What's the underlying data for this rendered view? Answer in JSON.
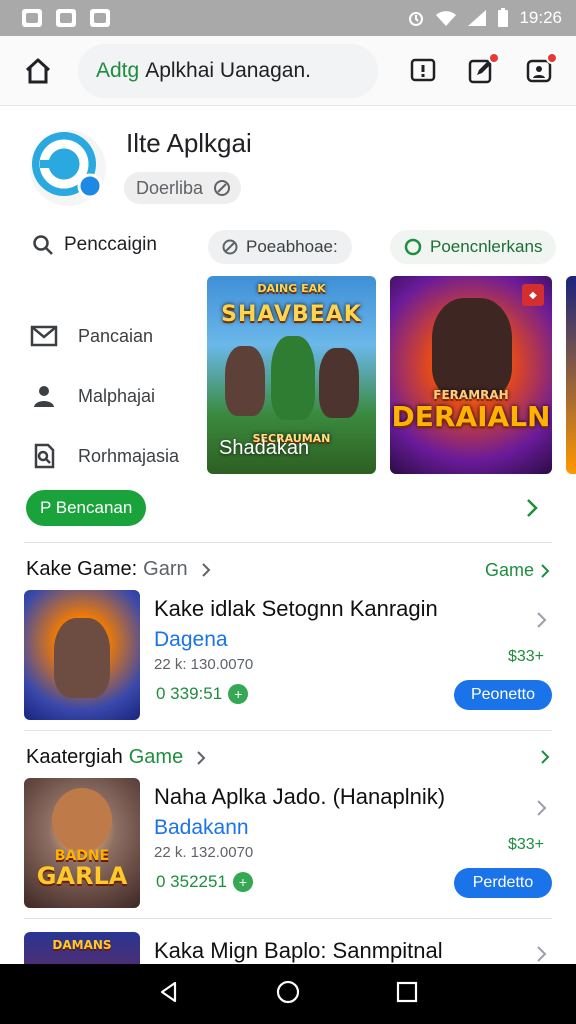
{
  "status_bar": {
    "time": "19:26"
  },
  "top_bar": {
    "search_prefix": "Adtg",
    "search_text": "Aplkhai Uanagan."
  },
  "app_header": {
    "title": "Ilte Aplkgai",
    "chip_label": "Doerliba"
  },
  "filters": {
    "search_label": "Penccaigin",
    "chip_1": "Poeabhoae:",
    "chip_2": "Poencnlerkans"
  },
  "side_menu": [
    {
      "label": "Pancaian",
      "icon": "mail-icon"
    },
    {
      "label": "Malphajai",
      "icon": "person-icon"
    },
    {
      "label": "Rorhmajasia",
      "icon": "document-search-icon"
    }
  ],
  "banners": [
    {
      "caption": "Shadakan",
      "art_title": "SHAVBEAK",
      "art_top": "DAING EAK",
      "art_sub": "SECRAUMAN"
    },
    {
      "art_title": "DERAIALN",
      "art_top": "FERAMRAH"
    }
  ],
  "cta": {
    "label": "P Bencanan"
  },
  "section_1": {
    "title": "Kake Game:",
    "sub": "Garn",
    "link": "Game"
  },
  "section_2": {
    "title": "Kaatergiah",
    "sub": "Game"
  },
  "apps": [
    {
      "title": "Kake idlak Setognn Kanragin",
      "developer": "Dagena",
      "meta": "22 k: 130.0070",
      "rating": "0 339:51",
      "price": "$33+",
      "button": "Peonetto"
    },
    {
      "title": "Naha Aplka Jado. (Hanaplnik)",
      "developer": "Badakann",
      "meta": "22 k. 132.0070",
      "rating": "0 352251",
      "price": "$33+",
      "button": "Perdetto",
      "thumb_text": "GARLA",
      "thumb_top": "BADNE"
    },
    {
      "title": "Kaka Mign Baplo: Sanmpitnal",
      "thumb_top": "DAMANS"
    }
  ],
  "colors": {
    "accent_green": "#1e8e3e",
    "accent_blue": "#1a73e8",
    "status_bar": "#a9a9a9"
  }
}
